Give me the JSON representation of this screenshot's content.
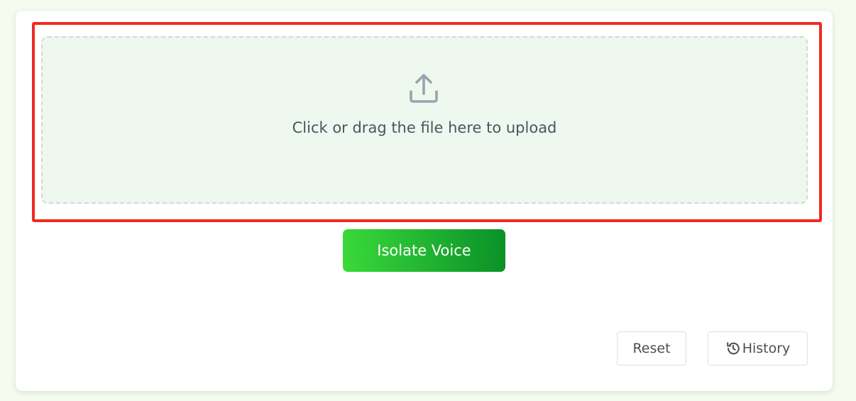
{
  "upload": {
    "prompt": "Click or drag the file here to upload",
    "icon": "upload-icon"
  },
  "actions": {
    "primary_label": "Isolate Voice",
    "reset_label": "Reset",
    "history_label": "History",
    "history_icon": "history-icon"
  },
  "colors": {
    "page_bg": "#f5fcef",
    "dropzone_bg": "#eef8ee",
    "highlight": "#f02a21",
    "primary_start": "#3ad93a",
    "primary_end": "#0a9128"
  }
}
